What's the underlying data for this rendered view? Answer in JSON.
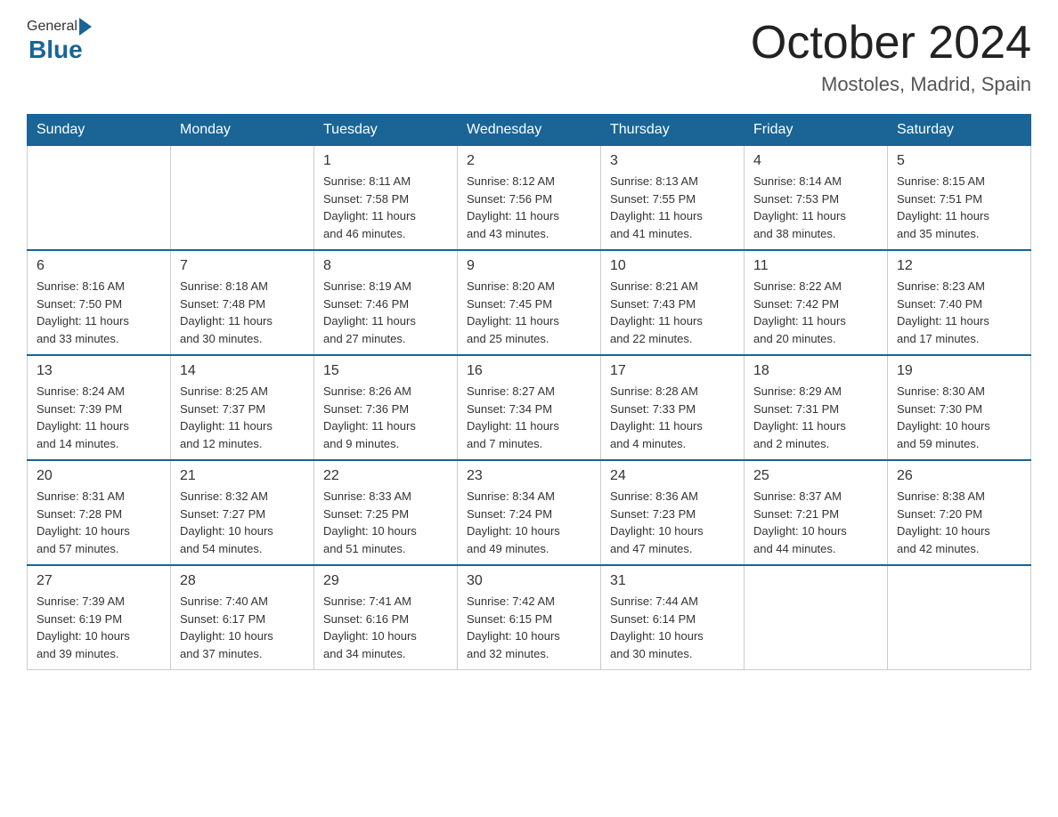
{
  "header": {
    "logo_general": "General",
    "logo_blue": "Blue",
    "month_title": "October 2024",
    "location": "Mostoles, Madrid, Spain"
  },
  "days_of_week": [
    "Sunday",
    "Monday",
    "Tuesday",
    "Wednesday",
    "Thursday",
    "Friday",
    "Saturday"
  ],
  "weeks": [
    [
      {
        "day": "",
        "info": ""
      },
      {
        "day": "",
        "info": ""
      },
      {
        "day": "1",
        "info": "Sunrise: 8:11 AM\nSunset: 7:58 PM\nDaylight: 11 hours\nand 46 minutes."
      },
      {
        "day": "2",
        "info": "Sunrise: 8:12 AM\nSunset: 7:56 PM\nDaylight: 11 hours\nand 43 minutes."
      },
      {
        "day": "3",
        "info": "Sunrise: 8:13 AM\nSunset: 7:55 PM\nDaylight: 11 hours\nand 41 minutes."
      },
      {
        "day": "4",
        "info": "Sunrise: 8:14 AM\nSunset: 7:53 PM\nDaylight: 11 hours\nand 38 minutes."
      },
      {
        "day": "5",
        "info": "Sunrise: 8:15 AM\nSunset: 7:51 PM\nDaylight: 11 hours\nand 35 minutes."
      }
    ],
    [
      {
        "day": "6",
        "info": "Sunrise: 8:16 AM\nSunset: 7:50 PM\nDaylight: 11 hours\nand 33 minutes."
      },
      {
        "day": "7",
        "info": "Sunrise: 8:18 AM\nSunset: 7:48 PM\nDaylight: 11 hours\nand 30 minutes."
      },
      {
        "day": "8",
        "info": "Sunrise: 8:19 AM\nSunset: 7:46 PM\nDaylight: 11 hours\nand 27 minutes."
      },
      {
        "day": "9",
        "info": "Sunrise: 8:20 AM\nSunset: 7:45 PM\nDaylight: 11 hours\nand 25 minutes."
      },
      {
        "day": "10",
        "info": "Sunrise: 8:21 AM\nSunset: 7:43 PM\nDaylight: 11 hours\nand 22 minutes."
      },
      {
        "day": "11",
        "info": "Sunrise: 8:22 AM\nSunset: 7:42 PM\nDaylight: 11 hours\nand 20 minutes."
      },
      {
        "day": "12",
        "info": "Sunrise: 8:23 AM\nSunset: 7:40 PM\nDaylight: 11 hours\nand 17 minutes."
      }
    ],
    [
      {
        "day": "13",
        "info": "Sunrise: 8:24 AM\nSunset: 7:39 PM\nDaylight: 11 hours\nand 14 minutes."
      },
      {
        "day": "14",
        "info": "Sunrise: 8:25 AM\nSunset: 7:37 PM\nDaylight: 11 hours\nand 12 minutes."
      },
      {
        "day": "15",
        "info": "Sunrise: 8:26 AM\nSunset: 7:36 PM\nDaylight: 11 hours\nand 9 minutes."
      },
      {
        "day": "16",
        "info": "Sunrise: 8:27 AM\nSunset: 7:34 PM\nDaylight: 11 hours\nand 7 minutes."
      },
      {
        "day": "17",
        "info": "Sunrise: 8:28 AM\nSunset: 7:33 PM\nDaylight: 11 hours\nand 4 minutes."
      },
      {
        "day": "18",
        "info": "Sunrise: 8:29 AM\nSunset: 7:31 PM\nDaylight: 11 hours\nand 2 minutes."
      },
      {
        "day": "19",
        "info": "Sunrise: 8:30 AM\nSunset: 7:30 PM\nDaylight: 10 hours\nand 59 minutes."
      }
    ],
    [
      {
        "day": "20",
        "info": "Sunrise: 8:31 AM\nSunset: 7:28 PM\nDaylight: 10 hours\nand 57 minutes."
      },
      {
        "day": "21",
        "info": "Sunrise: 8:32 AM\nSunset: 7:27 PM\nDaylight: 10 hours\nand 54 minutes."
      },
      {
        "day": "22",
        "info": "Sunrise: 8:33 AM\nSunset: 7:25 PM\nDaylight: 10 hours\nand 51 minutes."
      },
      {
        "day": "23",
        "info": "Sunrise: 8:34 AM\nSunset: 7:24 PM\nDaylight: 10 hours\nand 49 minutes."
      },
      {
        "day": "24",
        "info": "Sunrise: 8:36 AM\nSunset: 7:23 PM\nDaylight: 10 hours\nand 47 minutes."
      },
      {
        "day": "25",
        "info": "Sunrise: 8:37 AM\nSunset: 7:21 PM\nDaylight: 10 hours\nand 44 minutes."
      },
      {
        "day": "26",
        "info": "Sunrise: 8:38 AM\nSunset: 7:20 PM\nDaylight: 10 hours\nand 42 minutes."
      }
    ],
    [
      {
        "day": "27",
        "info": "Sunrise: 7:39 AM\nSunset: 6:19 PM\nDaylight: 10 hours\nand 39 minutes."
      },
      {
        "day": "28",
        "info": "Sunrise: 7:40 AM\nSunset: 6:17 PM\nDaylight: 10 hours\nand 37 minutes."
      },
      {
        "day": "29",
        "info": "Sunrise: 7:41 AM\nSunset: 6:16 PM\nDaylight: 10 hours\nand 34 minutes."
      },
      {
        "day": "30",
        "info": "Sunrise: 7:42 AM\nSunset: 6:15 PM\nDaylight: 10 hours\nand 32 minutes."
      },
      {
        "day": "31",
        "info": "Sunrise: 7:44 AM\nSunset: 6:14 PM\nDaylight: 10 hours\nand 30 minutes."
      },
      {
        "day": "",
        "info": ""
      },
      {
        "day": "",
        "info": ""
      }
    ]
  ]
}
